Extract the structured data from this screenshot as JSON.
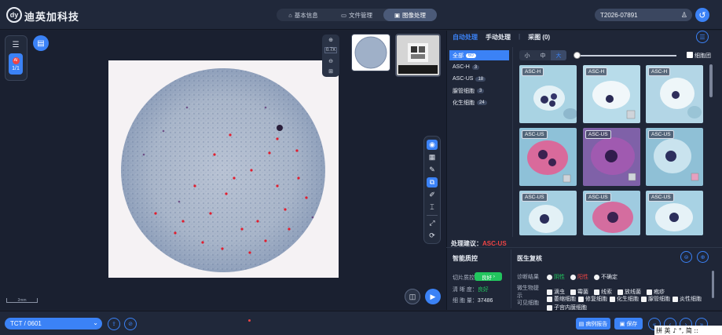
{
  "header": {
    "logo_text": "dy",
    "brand": "迪英加科技",
    "tabs": [
      {
        "icon": "home-icon",
        "label": "基本信息",
        "active": false
      },
      {
        "icon": "folder-icon",
        "label": "文件管理",
        "active": false
      },
      {
        "icon": "image-icon",
        "label": "图像处理",
        "active": true
      }
    ],
    "patient_id": "T2026-07891"
  },
  "viewer": {
    "ai_label": "AI",
    "ai_count": "1/1",
    "zoom_level": "0.7X",
    "scale_label": "2mm",
    "tools": [
      "eye-icon",
      "grid-icon",
      "brush-icon",
      "select-icon",
      "ruler-icon",
      "measure-icon",
      "fullscreen-icon",
      "rotate-icon"
    ],
    "active_tools": [
      0,
      3
    ]
  },
  "right_panel": {
    "tabs": [
      "自动处理",
      "手动处理",
      "采图",
      "(0)"
    ],
    "categories": [
      {
        "label": "全部",
        "count": "60",
        "active": true
      },
      {
        "label": "ASC-H",
        "count": "3",
        "active": false
      },
      {
        "label": "ASC-US",
        "count": "18",
        "active": false
      },
      {
        "label": "腺管细胞",
        "count": "3",
        "active": false
      },
      {
        "label": "化生细胞",
        "count": "24",
        "active": false
      }
    ],
    "size_options": [
      {
        "label": "小",
        "active": false
      },
      {
        "label": "中",
        "active": false
      },
      {
        "label": "大",
        "active": true
      }
    ],
    "slider_value": 0,
    "cell_group_label": "细胞团",
    "cells": [
      "ASC-H",
      "ASC-H",
      "ASC-H",
      "ASC-US",
      "ASC-US",
      "ASC-US",
      "ASC-US",
      "ASC-US",
      "ASC-US"
    ],
    "advice_label": "处理建议：",
    "advice_value": "ASC-US",
    "qc": {
      "title": "智能质控",
      "slide_quality_label": "切片质控：",
      "slide_quality_value": "良好",
      "clarity_label": "清 晰 度：",
      "clarity_value": "良好",
      "cell_count_label": "细 胞 量：",
      "cell_count_value": "37486"
    },
    "review": {
      "title": "医生复核",
      "diagnosis_label": "诊断结果",
      "diagnosis_options": [
        "阴性",
        "阳性",
        "不确定"
      ],
      "microbe_label": "微生物提示",
      "microbe_options": [
        "滴虫",
        "霉菌",
        "线索",
        "放线菌",
        "疱疹"
      ],
      "visible_label": "可见细胞",
      "visible_options": [
        "萎缩细胞",
        "修复细胞",
        "化生细胞",
        "腺管细胞",
        "炎性细胞",
        "子宫内膜细胞"
      ]
    }
  },
  "footer": {
    "slide_select": "TCT / 0601",
    "print_report": "病例报告",
    "save": "保存",
    "nav_icons": [
      "first-icon",
      "prev-icon",
      "next-icon",
      "last-icon"
    ]
  },
  "ime": {
    "text": "拼 英 ♪ °, 简 ::"
  },
  "colors": {
    "accent": "#3b82f6",
    "alert": "#ef4444",
    "ok": "#22c55e",
    "background": "#1c2230"
  }
}
